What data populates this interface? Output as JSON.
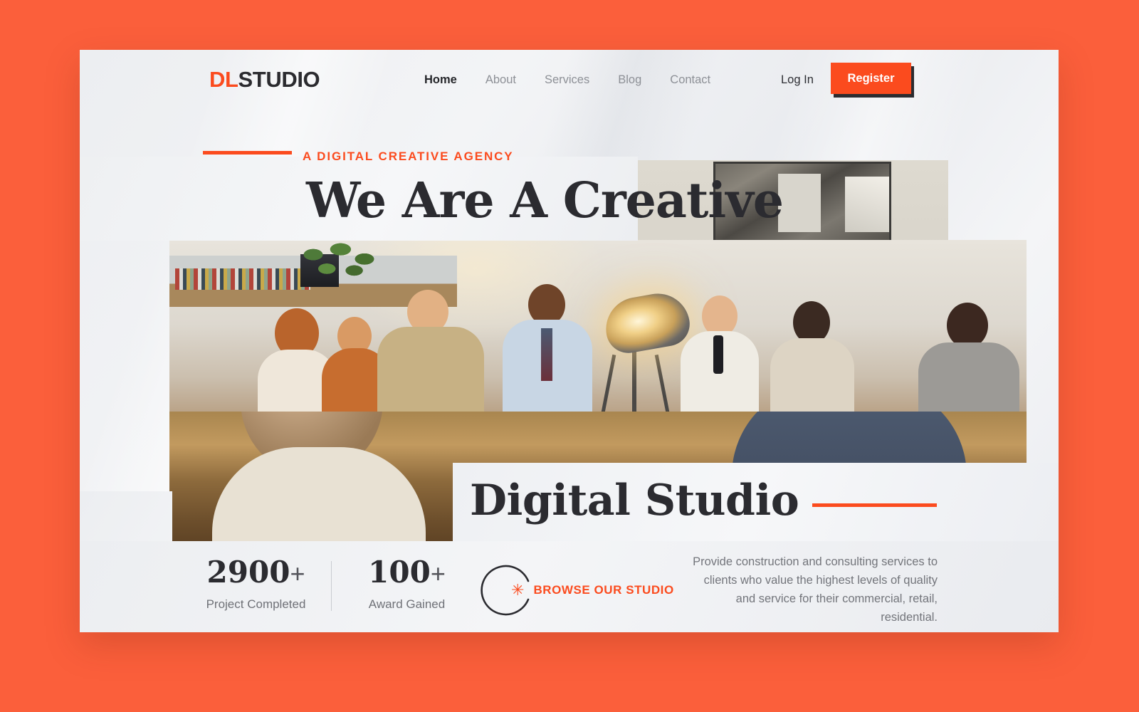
{
  "theme": {
    "accent": "#FB4B1E",
    "background": "#FB5F3B",
    "card": "#f1f2f5",
    "dark_text": "#2b2b30",
    "muted_text": "#8d9096"
  },
  "header": {
    "logo": {
      "first": "DL",
      "second": "STUDIO"
    },
    "nav": [
      {
        "label": "Home",
        "active": true
      },
      {
        "label": "About",
        "active": false
      },
      {
        "label": "Services",
        "active": false
      },
      {
        "label": "Blog",
        "active": false
      },
      {
        "label": "Contact",
        "active": false
      }
    ],
    "login_label": "Log In",
    "register_label": "Register"
  },
  "hero": {
    "eyebrow": "A DIGITAL CREATIVE AGENCY",
    "headline_line1": "We Are A Creative",
    "headline_line2": "Digital Studio"
  },
  "stats": [
    {
      "value": "2900",
      "suffix": "+",
      "label": "Project Completed"
    },
    {
      "value": "100",
      "suffix": "+",
      "label": "Award Gained"
    }
  ],
  "cta": {
    "asterisk": "✳",
    "label": "BROWSE OUR STUDIO"
  },
  "blurb": {
    "text": "Provide construction and consulting services to clients who value the highest levels of quality and service for their commercial, retail,  residential."
  },
  "icons": {
    "asterisk_icon": "asterisk-icon",
    "ring_icon": "open-circle-icon"
  }
}
